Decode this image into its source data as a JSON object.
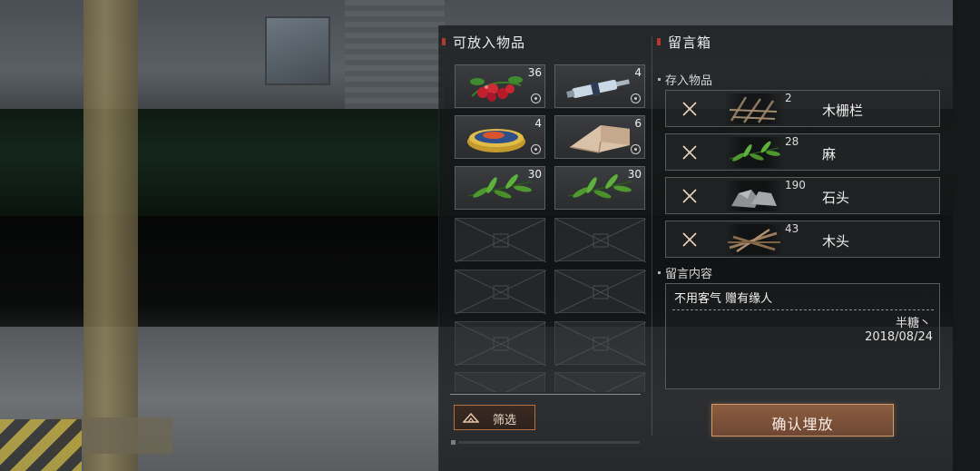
{
  "left_panel": {
    "title": "可放入物品",
    "items": [
      {
        "name": "berries",
        "icon": "berries-icon",
        "count": "36"
      },
      {
        "name": "syringe",
        "icon": "syringe-icon",
        "count": "4"
      },
      {
        "name": "canned-food",
        "icon": "canned-food-icon",
        "count": "4"
      },
      {
        "name": "cloth",
        "icon": "cloth-icon",
        "count": "6"
      },
      {
        "name": "hemp",
        "icon": "hemp-icon",
        "count": "30"
      },
      {
        "name": "hemp",
        "icon": "hemp-icon",
        "count": "30"
      }
    ],
    "filter_label": "筛选"
  },
  "right_panel": {
    "title": "留言箱",
    "stored_label": "存入物品",
    "stored_items": [
      {
        "name": "木栅栏",
        "count": "2",
        "icon": "wooden-fence-icon"
      },
      {
        "name": "麻",
        "count": "28",
        "icon": "hemp-icon"
      },
      {
        "name": "石头",
        "count": "190",
        "icon": "stone-icon"
      },
      {
        "name": "木头",
        "count": "43",
        "icon": "wood-icon"
      }
    ],
    "message_label": "留言内容",
    "message": {
      "text": "不用客气 赠有缘人",
      "author": "半糖丶",
      "date": "2018/08/24"
    },
    "confirm_label": "确认埋放"
  },
  "colors": {
    "accent_red": "#b33a2a",
    "button_border": "#d59a6a",
    "filter_border": "#b5703f"
  }
}
